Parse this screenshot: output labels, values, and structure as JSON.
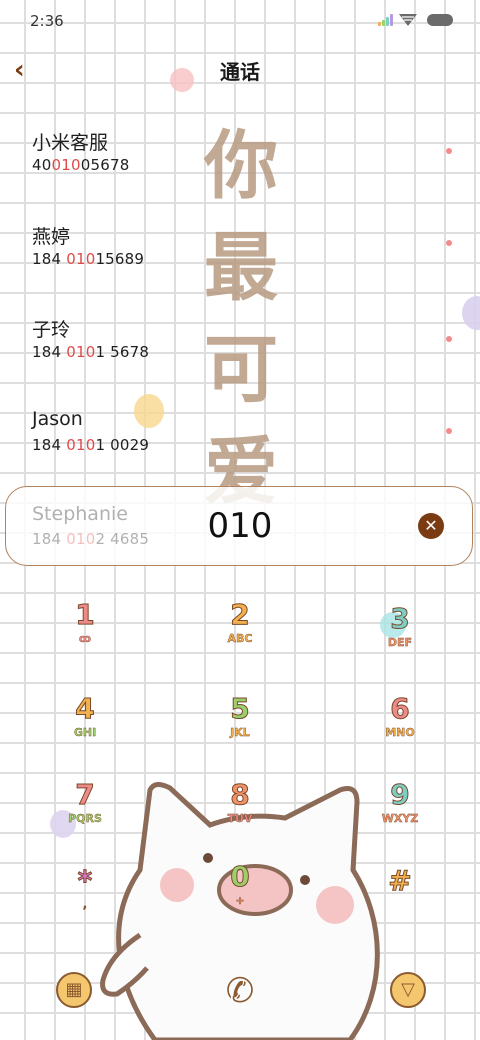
{
  "status_bar": {
    "time": "2:36"
  },
  "header": {
    "title": "通话",
    "back_icon": "chevron-left-icon"
  },
  "decor": {
    "chars": [
      "你",
      "最",
      "可",
      "爱"
    ]
  },
  "contacts": [
    {
      "name": "小米客服",
      "pre": "40",
      "hl": "010",
      "post": "05678"
    },
    {
      "name": "燕婷",
      "pre": "184 ",
      "hl": "010",
      "post": "15689"
    },
    {
      "name": "子玲",
      "pre": "184 ",
      "hl": "010",
      "post": "1 5678"
    },
    {
      "name": "Jason",
      "pre": "184 ",
      "hl": "010",
      "post": "1 0029"
    },
    {
      "name": "Stephanie",
      "pre": "184 ",
      "hl": "010",
      "post": "2 4685"
    }
  ],
  "dial_input": {
    "value": "010",
    "clear_icon": "clear-icon"
  },
  "keypad": [
    {
      "digit": "1",
      "letters": "ꝏ",
      "color": "#ef8a8a"
    },
    {
      "digit": "2",
      "letters": "ABC",
      "color": "#f2b04e"
    },
    {
      "digit": "3",
      "letters": "DEF",
      "color": "#f0916a"
    },
    {
      "digit": "4",
      "letters": "GHI",
      "color": "#f2b04e"
    },
    {
      "digit": "5",
      "letters": "JKL",
      "color": "#9bd06b"
    },
    {
      "digit": "6",
      "letters": "MNO",
      "color": "#ef8a8a"
    },
    {
      "digit": "7",
      "letters": "PQRS",
      "color": "#ef8a8a"
    },
    {
      "digit": "8",
      "letters": "TUV",
      "color": "#f0916a"
    },
    {
      "digit": "9",
      "letters": "WXYZ",
      "color": "#7dcfc6"
    },
    {
      "digit": "*",
      "letters": ",",
      "color": "#e07ad8"
    },
    {
      "digit": "0",
      "letters": "+",
      "color": "#9bd06b"
    },
    {
      "digit": "#",
      "letters": "",
      "color": "#f2b04e"
    }
  ],
  "bottom_bar": {
    "left_icon": "keypad-toggle-icon",
    "center_icon": "phone-call-icon",
    "right_icon": "sim-select-icon"
  }
}
